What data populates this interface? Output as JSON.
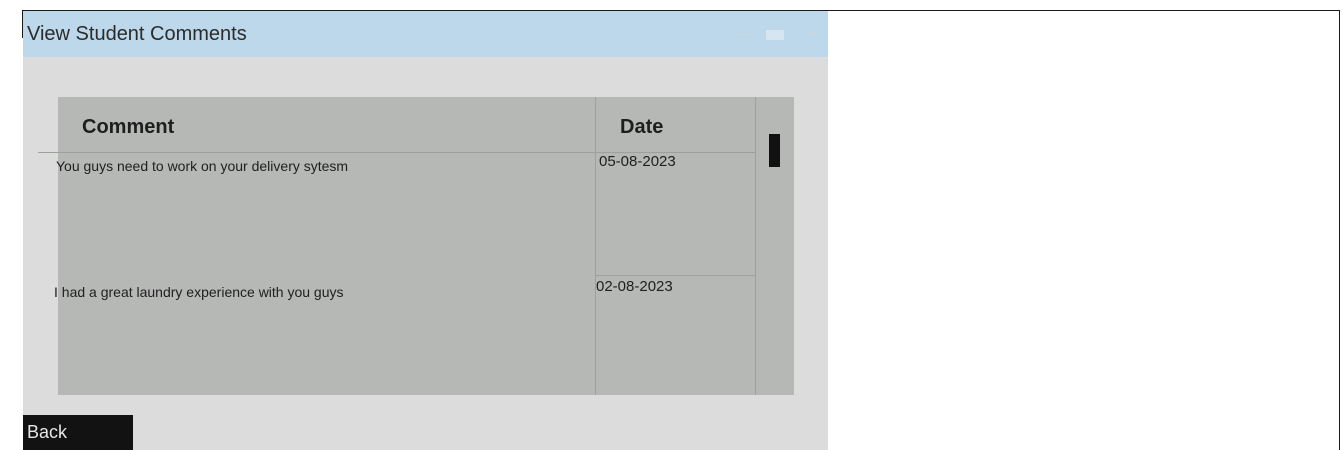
{
  "window": {
    "title": "View Student Comments",
    "controls": {
      "minimize_icon": "minimize-icon",
      "maximize_icon": "maximize-icon",
      "close_glyph": "×"
    }
  },
  "table": {
    "columns": [
      "Comment",
      "Date"
    ],
    "rows": [
      {
        "comment": "You guys need to work on your delivery sytesm",
        "date": "05-08-2023"
      },
      {
        "comment": "I had a great laundry experience with you guys",
        "date": "02-08-2023"
      }
    ]
  },
  "actions": {
    "back_label": "Back"
  },
  "colors": {
    "titlebar": "#bcd8ea",
    "window_bg": "#dcdcdc",
    "table_bg": "#b6b8b6",
    "button_bg": "#121212"
  }
}
